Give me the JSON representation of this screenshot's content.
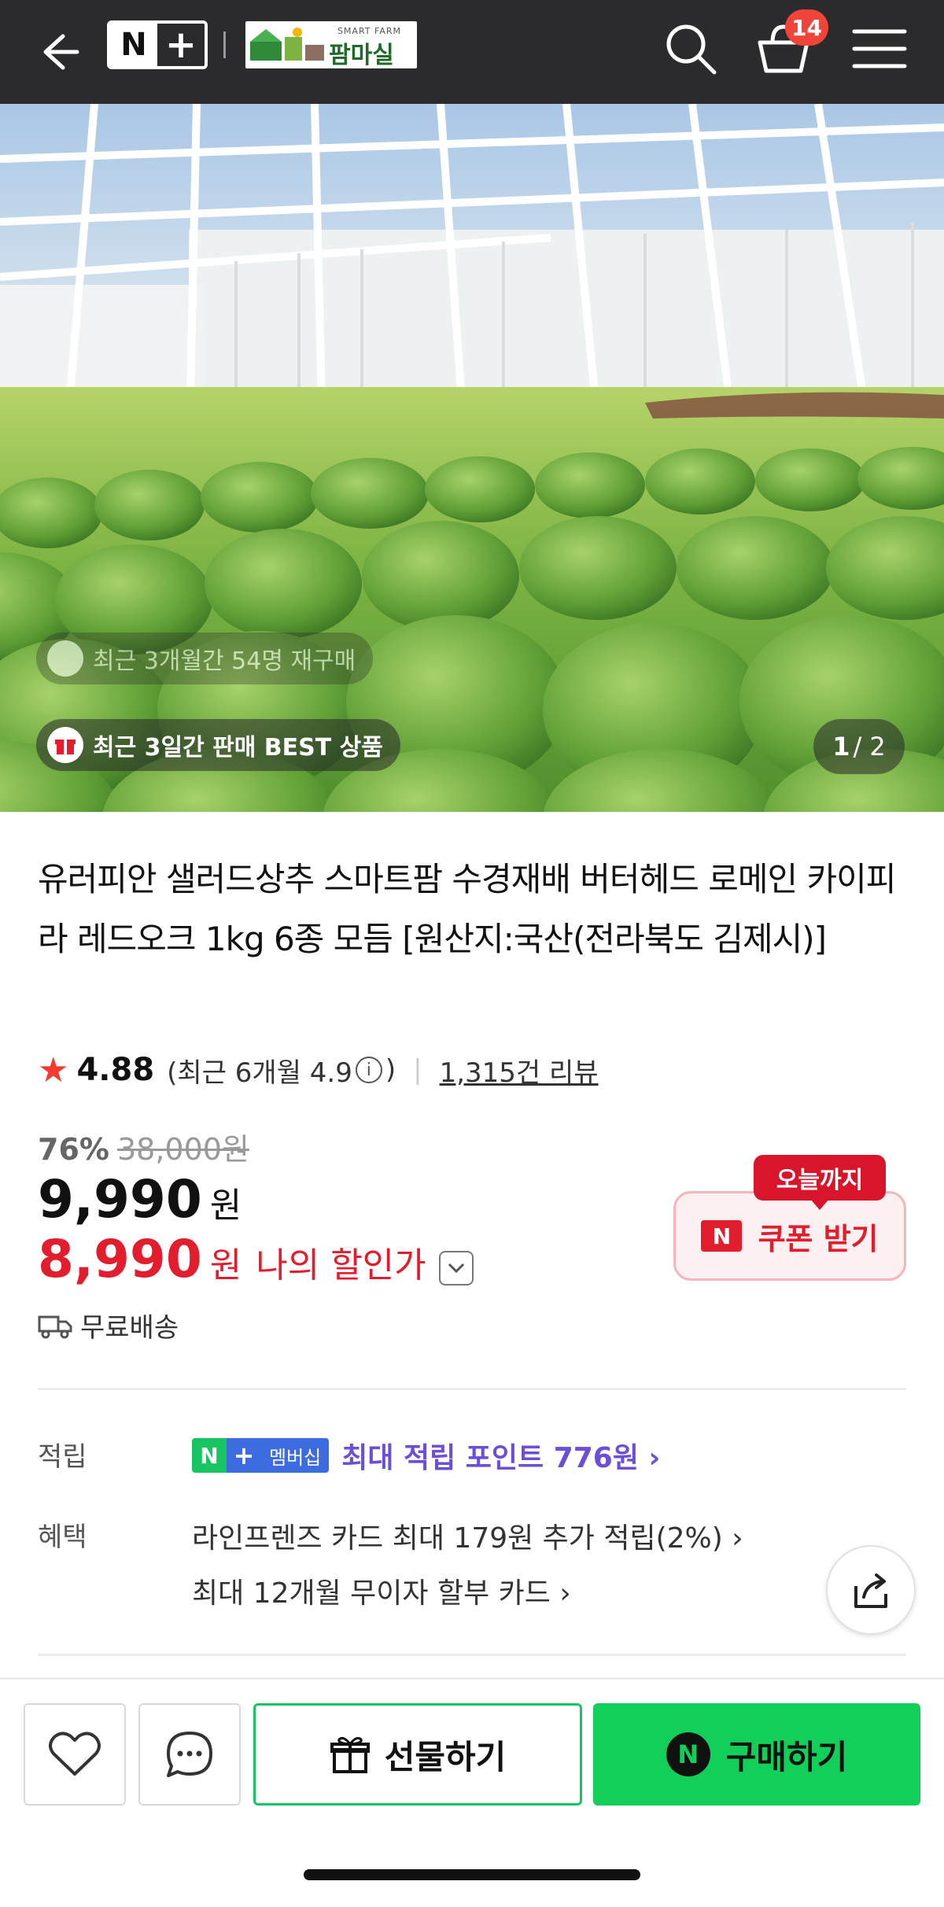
{
  "header": {
    "brand_n": "N",
    "brand_plus": "+",
    "store_logo_small": "SMART FARM",
    "store_logo_name": "팜마실",
    "cart_count": "14"
  },
  "hero": {
    "chip_repurchase": "최근 3개월간 54명 재구매",
    "chip_best": "최근 3일간 판매 BEST 상품",
    "page_current": "1",
    "page_total": "/ 2"
  },
  "product": {
    "title": "유러피안 샐러드상추 스마트팜 수경재배 버터헤드 로메인 카이피라 레드오크 1kg 6종 모듬 [원산지:국산(전라북도 김제시)]",
    "rating": "4.88",
    "recent_rating_prefix": "(최근 6개월 4.9",
    "recent_rating_suffix": ")",
    "reviews": "1,315건 리뷰",
    "discount_rate": "76%",
    "original_price": "38,000원",
    "price": "9,990",
    "price_unit": "원",
    "my_price": "8,990",
    "my_price_unit": "원",
    "my_price_label": "나의 할인가",
    "shipping": "무료배송"
  },
  "coupon": {
    "badge": "오늘까지",
    "n_logo": "N",
    "label": "쿠폰 받기"
  },
  "points": {
    "label": "적립",
    "badge_n": "N",
    "badge_plus": "+",
    "badge_member": "멤버십",
    "text": "최대 적립 포인트 776원 ›"
  },
  "benefits": {
    "label": "혜택",
    "line1": "라인프렌즈 카드 최대 179원 추가 적립(2%) ›",
    "line2": "최대 12개월 무이자 할부 카드 ›"
  },
  "bottom_bar": {
    "gift": "선물하기",
    "buy_logo": "N",
    "buy": "구매하기"
  },
  "colors": {
    "header_bg": "#2b2b2d",
    "sale_red": "#e11d2e",
    "naver_green": "#11cf59",
    "membership_purple": "#6c4fd8"
  },
  "icons": [
    "back-arrow-icon",
    "search-icon",
    "cart-icon",
    "menu-icon",
    "repurchase-icon",
    "gift-box-icon",
    "info-icon",
    "star-icon",
    "chevron-down-icon",
    "truck-icon",
    "share-icon",
    "heart-icon",
    "chat-icon",
    "gift-icon"
  ]
}
